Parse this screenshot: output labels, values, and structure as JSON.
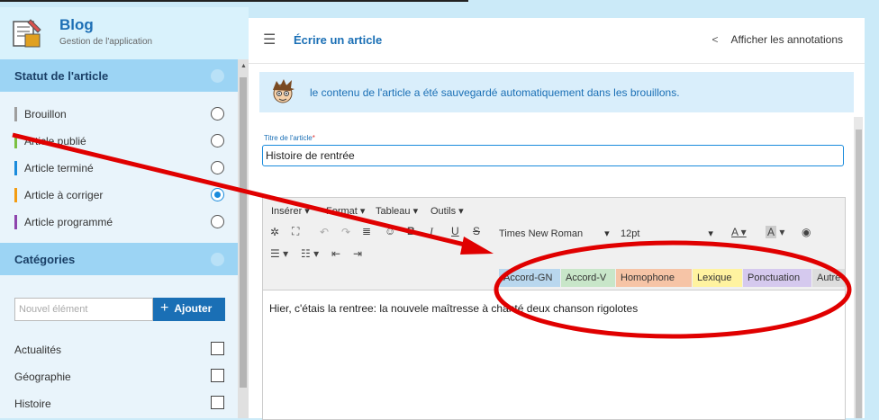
{
  "app": {
    "title": "Blog",
    "subtitle": "Gestion de l'application"
  },
  "sidebar": {
    "status_title": "Statut de l'article",
    "statuses": [
      {
        "label": "Brouillon",
        "color": "#9e9e9e",
        "selected": false
      },
      {
        "label": "Article publié",
        "color": "#7bc043",
        "selected": false
      },
      {
        "label": "Article terminé",
        "color": "#1a8bdc",
        "selected": false
      },
      {
        "label": "Article à corriger",
        "color": "#f39c12",
        "selected": true
      },
      {
        "label": "Article programmé",
        "color": "#8e44ad",
        "selected": false
      }
    ],
    "categories_title": "Catégories",
    "new_item_placeholder": "Nouvel élément",
    "add_button": "Ajouter",
    "categories": [
      {
        "label": "Actualités",
        "checked": false
      },
      {
        "label": "Géographie",
        "checked": false
      },
      {
        "label": "Histoire",
        "checked": false
      }
    ]
  },
  "main": {
    "page_title": "Écrire un article",
    "annotations_link": "Afficher les annotations",
    "banner_text": "le contenu de l'article a été sauvegardé automatiquement dans les brouillons.",
    "title_label": "Titre de l'article",
    "title_required": "*",
    "title_value": "Histoire de rentrée",
    "editor": {
      "menus": [
        "Insérer",
        "Format",
        "Tableau",
        "Outils"
      ],
      "font_family": "Times New Roman",
      "font_size": "12pt",
      "tags": [
        {
          "label": "Accord-GN",
          "color": "#b9d7ee"
        },
        {
          "label": "Accord-V",
          "color": "#c8e6c9"
        },
        {
          "label": "Homophone",
          "color": "#f6c4a6"
        },
        {
          "label": "Lexique",
          "color": "#fff3a0"
        },
        {
          "label": "Ponctuation",
          "color": "#d5c9ee"
        },
        {
          "label": "Autre",
          "color": "#dddddd"
        }
      ],
      "content": "Hier, c'étais la rentree: la nouvele maîtresse à chanté deux chanson rigolotes"
    }
  },
  "annotation_color": "#e00000"
}
